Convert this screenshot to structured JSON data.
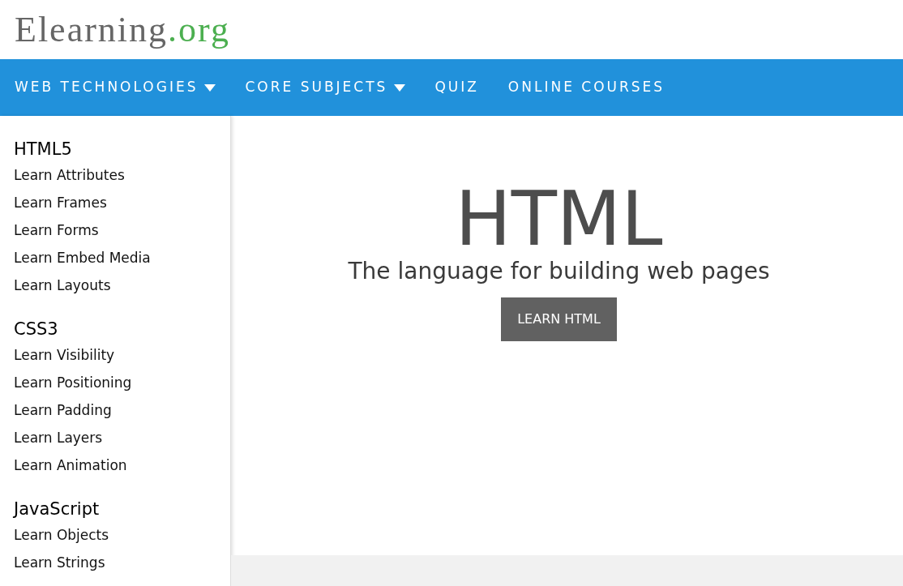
{
  "logo": {
    "name": "Elearning",
    "suffix": ".org"
  },
  "nav": [
    {
      "label": "WEB TECHNOLOGIES",
      "dropdown": true
    },
    {
      "label": "CORE SUBJECTS",
      "dropdown": true
    },
    {
      "label": "QUIZ",
      "dropdown": false
    },
    {
      "label": "ONLINE COURSES",
      "dropdown": false
    }
  ],
  "sidebar": [
    {
      "heading": "HTML5",
      "items": [
        "Learn Attributes",
        "Learn Frames",
        "Learn Forms",
        "Learn Embed Media",
        "Learn Layouts"
      ]
    },
    {
      "heading": "CSS3",
      "items": [
        "Learn Visibility",
        "Learn Positioning",
        "Learn Padding",
        "Learn Layers",
        "Learn Animation"
      ]
    },
    {
      "heading": "JavaScript",
      "items": [
        "Learn Objects",
        "Learn Strings"
      ]
    }
  ],
  "hero": {
    "title": "HTML",
    "subtitle": "The language for building web pages",
    "button": "LEARN HTML"
  }
}
